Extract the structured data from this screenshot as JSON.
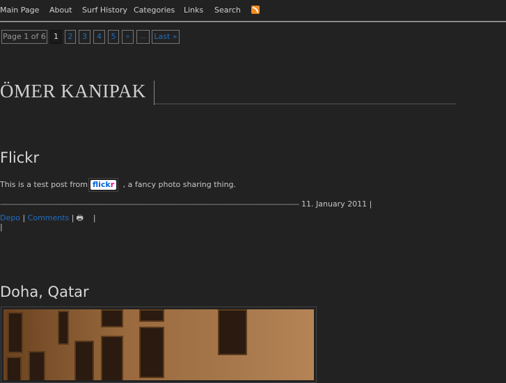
{
  "nav": {
    "items": [
      "Main Page",
      "About",
      "Surf History",
      "Categories",
      "Links",
      "Search"
    ],
    "rss_icon": "rss-icon"
  },
  "pagination": {
    "status": "Page 1 of 6",
    "current": "1",
    "pages": [
      "2",
      "3",
      "4",
      "5"
    ],
    "next": "»",
    "ellipsis": "...",
    "last": "Last »"
  },
  "site_title": "ÖMER KANIPAK",
  "posts": [
    {
      "title": "Flickr",
      "text_before": "This is a test post from",
      "badge": "flickr",
      "text_after": ", a fancy photo sharing thing.",
      "date": "11. January 2011",
      "category": "Depo",
      "comments": "Comments"
    },
    {
      "title": "Doha, Qatar"
    }
  ],
  "colors": {
    "background": "#222222",
    "link": "#1f6fc4"
  }
}
